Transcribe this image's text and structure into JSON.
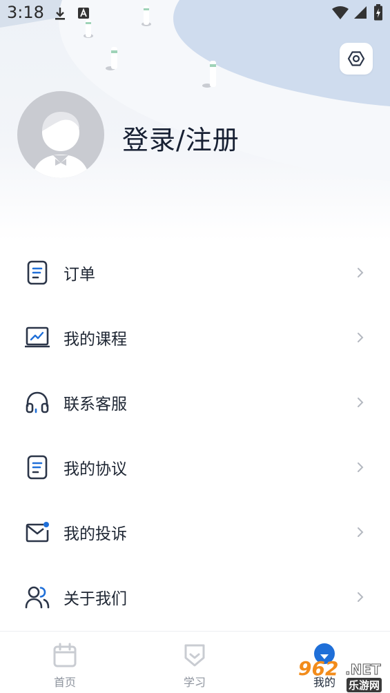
{
  "status_bar": {
    "time": "3:18",
    "icons": [
      "download-icon",
      "a-notification-icon",
      "wifi-icon",
      "signal-icon",
      "battery-charging-icon"
    ]
  },
  "header": {
    "settings_icon": "settings-hexagon-icon",
    "avatar_icon": "default-avatar-icon",
    "login_label": "登录/注册"
  },
  "menu": {
    "items": [
      {
        "label": "订单",
        "icon": "order-doc-icon"
      },
      {
        "label": "我的课程",
        "icon": "course-chart-icon"
      },
      {
        "label": "联系客服",
        "icon": "headset-icon"
      },
      {
        "label": "我的协议",
        "icon": "agreement-doc-icon"
      },
      {
        "label": "我的投诉",
        "icon": "mail-icon"
      },
      {
        "label": "关于我们",
        "icon": "users-icon"
      }
    ]
  },
  "bottom_nav": {
    "items": [
      {
        "label": "首页",
        "icon": "calendar-home-icon",
        "active": false
      },
      {
        "label": "学习",
        "icon": "shield-study-icon",
        "active": false
      },
      {
        "label": "我的",
        "icon": "profile-icon",
        "active": true
      }
    ]
  },
  "watermark": {
    "number": "962",
    "suffix": ".NET",
    "sub": "乐游网"
  },
  "colors": {
    "accent": "#1f6fd8",
    "icon_stroke": "#2b3548",
    "chevron": "#b4b8c0",
    "nav_inactive": "#8e949e",
    "header_bg": "#eef2f7"
  }
}
